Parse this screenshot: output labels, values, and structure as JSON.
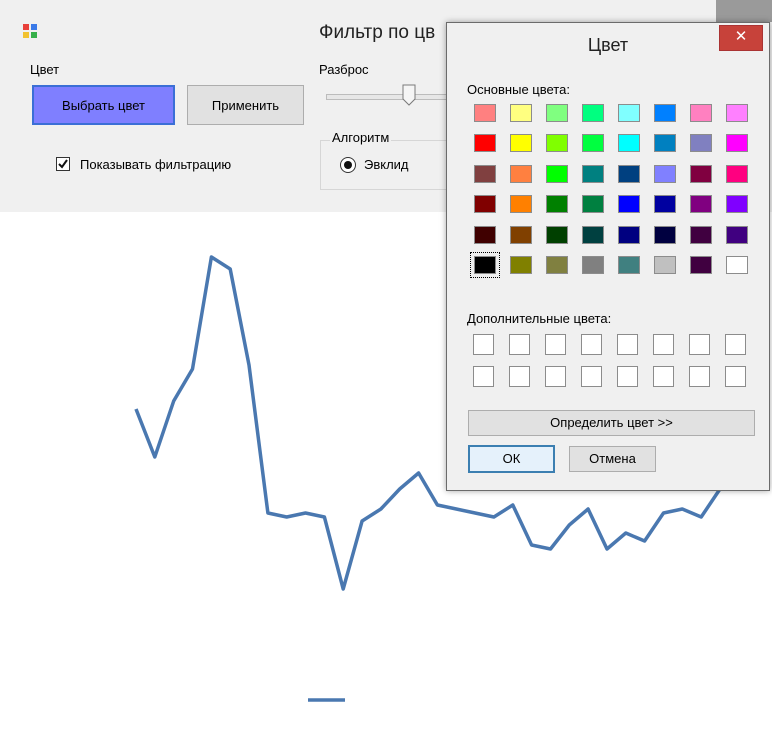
{
  "main_window": {
    "title": "Фильтр по цв",
    "color_label": "Цвет",
    "choose_color_button": "Выбрать цвет",
    "apply_button": "Применить",
    "show_filter_checkbox": "Показывать фильтрацию",
    "show_filter_checked": true,
    "spread_label": "Разброс",
    "spread_value": 0.64,
    "algorithm_group": "Алгоритм",
    "algorithm_option": "Эвклид",
    "algorithm_selected": true
  },
  "chart_data": {
    "type": "line",
    "y_tick_labels": [
      "",
      "",
      "",
      "",
      "",
      "",
      "",
      ""
    ],
    "series": [
      {
        "values": [
          0.22,
          0.34,
          0.2,
          0.12,
          -0.16,
          -0.13,
          0.11,
          0.48,
          0.49,
          0.48,
          0.49,
          0.67,
          0.5,
          0.47,
          0.42,
          0.38,
          0.46,
          0.47,
          0.48,
          0.49,
          0.46,
          0.56,
          0.57,
          0.51,
          0.47,
          0.57,
          0.53,
          0.55,
          0.48,
          0.47,
          0.49,
          0.42
        ],
        "color": "#4a78b0"
      }
    ],
    "grid": false,
    "legend": "bottom"
  },
  "color_dialog": {
    "title": "Цвет",
    "close_symbol": "✕",
    "basic_colors_label": "Основные цвета:",
    "custom_colors_label": "Дополнительные цвета:",
    "define_button": "Определить цвет >>",
    "ok_button": "ОК",
    "cancel_button": "Отмена",
    "selected_index": 40,
    "basic_colors": [
      "#ff8080",
      "#ffff80",
      "#80ff80",
      "#00ff80",
      "#80ffff",
      "#0080ff",
      "#ff80c0",
      "#ff80ff",
      "#ff0000",
      "#ffff00",
      "#80ff00",
      "#00ff40",
      "#00ffff",
      "#0080c0",
      "#8080c0",
      "#ff00ff",
      "#804040",
      "#ff8040",
      "#00ff00",
      "#008080",
      "#004080",
      "#8080ff",
      "#800040",
      "#ff0080",
      "#800000",
      "#ff8000",
      "#008000",
      "#008040",
      "#0000ff",
      "#0000a0",
      "#800080",
      "#8000ff",
      "#400000",
      "#804000",
      "#004000",
      "#004040",
      "#000080",
      "#000040",
      "#400040",
      "#400080",
      "#000000",
      "#808000",
      "#808040",
      "#808080",
      "#408080",
      "#c0c0c0",
      "#400040",
      "#ffffff"
    ],
    "custom_colors": [
      "#ffffff",
      "#ffffff",
      "#ffffff",
      "#ffffff",
      "#ffffff",
      "#ffffff",
      "#ffffff",
      "#ffffff",
      "#ffffff",
      "#ffffff",
      "#ffffff",
      "#ffffff",
      "#ffffff",
      "#ffffff",
      "#ffffff",
      "#ffffff"
    ]
  }
}
